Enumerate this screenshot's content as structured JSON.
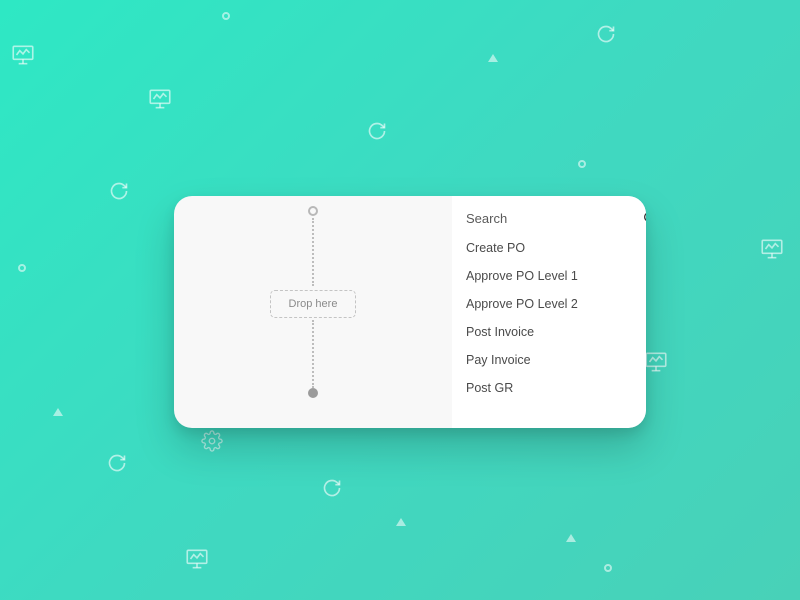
{
  "canvas": {
    "drop_label": "Drop here"
  },
  "search": {
    "placeholder": "Search"
  },
  "items": [
    {
      "label": "Create PO"
    },
    {
      "label": "Approve PO Level 1"
    },
    {
      "label": "Approve PO Level 2"
    },
    {
      "label": "Post Invoice"
    },
    {
      "label": "Pay Invoice"
    },
    {
      "label": "Post GR"
    }
  ]
}
